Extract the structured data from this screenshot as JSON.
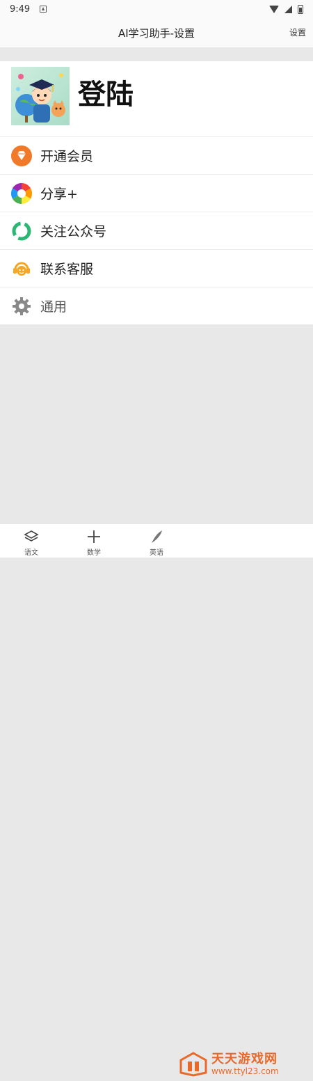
{
  "status_bar": {
    "time": "9:49"
  },
  "header": {
    "title": "AI学习助手-设置",
    "settings_label": "设置"
  },
  "profile": {
    "login_label": "登陆"
  },
  "menu": [
    {
      "label": "开通会员",
      "icon": "vip-diamond-icon"
    },
    {
      "label": "分享+",
      "icon": "share-aperture-icon"
    },
    {
      "label": "关注公众号",
      "icon": "wechat-official-account-icon"
    },
    {
      "label": "联系客服",
      "icon": "customer-service-icon"
    },
    {
      "label": "通用",
      "icon": "gear-icon"
    }
  ],
  "tabs": [
    {
      "label": "语文",
      "icon": "layers-icon"
    },
    {
      "label": "数学",
      "icon": "plus-icon"
    },
    {
      "label": "英语",
      "icon": "feather-icon"
    }
  ],
  "watermark": {
    "name": "天天游戏网",
    "url": "www.ttyl23.com"
  },
  "colors": {
    "brand_orange": "#e8692a",
    "vip_orange": "#f07a2a",
    "wechat_green": "#2bb673",
    "service_orange": "#f5a623"
  }
}
